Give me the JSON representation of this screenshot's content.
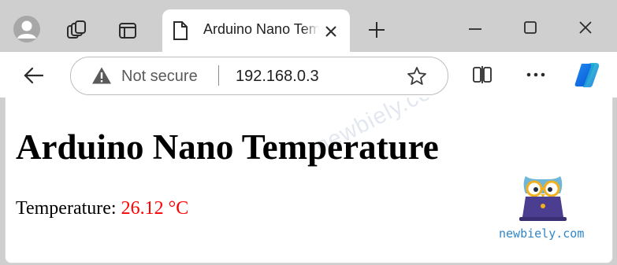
{
  "tab": {
    "title": "Arduino Nano Temperature"
  },
  "address_bar": {
    "security_label": "Not secure",
    "url": "192.168.0.3"
  },
  "page": {
    "heading": "Arduino Nano Temperature",
    "temperature_label": "Temperature: ",
    "temperature_value": "26.12 °C",
    "value_color": "#ff0000"
  },
  "watermark": {
    "diagonal_text": "newbiely.com",
    "brand_text": "newbiely.com",
    "brand_color": "#2f86c9"
  },
  "icons": {
    "profile": "avatar-icon",
    "workspaces": "workspaces-icon",
    "tab_actions": "tab-actions-icon",
    "page": "page-icon",
    "close_tab": "close-icon",
    "new_tab": "plus-icon",
    "minimize": "minimize-icon",
    "maximize": "maximize-icon",
    "close_window": "close-icon",
    "back": "back-arrow-icon",
    "warning": "warning-icon",
    "favorite": "star-icon",
    "split_screen": "split-screen-icon",
    "more": "more-icon",
    "copilot": "copilot-icon"
  }
}
